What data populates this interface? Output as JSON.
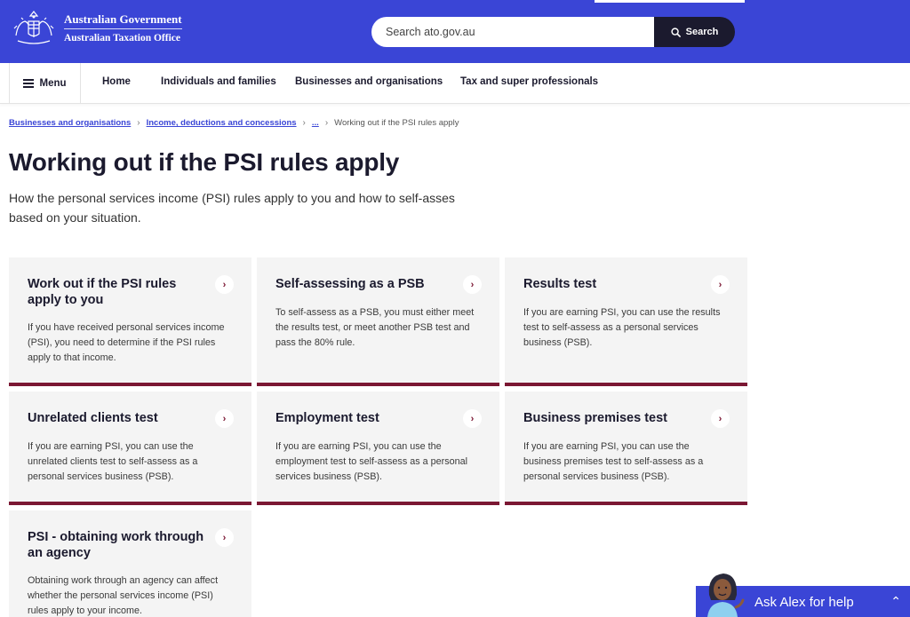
{
  "header": {
    "logo_line1": "Australian Government",
    "logo_line2": "Australian Taxation Office",
    "search_placeholder": "Search ato.gov.au",
    "search_button": "Search",
    "brand_color": "#3a45d6"
  },
  "nav": {
    "menu_label": "Menu",
    "items": [
      "Home",
      "Individuals and families",
      "Businesses and organisations",
      "Tax and super professionals"
    ]
  },
  "breadcrumb": {
    "items": [
      "Businesses and organisations",
      "Income, deductions and concessions",
      "..."
    ],
    "current": "Working out if the PSI rules apply"
  },
  "page": {
    "title": "Working out if the PSI rules apply",
    "intro": "How the personal services income (PSI) rules apply to you and how to self-asses based on your situation."
  },
  "cards": [
    {
      "title": "Work out if the PSI rules apply to you",
      "desc": "If you have received personal services income (PSI), you need to determine if the PSI rules apply to that income."
    },
    {
      "title": "Self-assessing as a PSB",
      "desc": "To self-assess as a PSB, you must either meet the results test, or meet another PSB test and pass the 80% rule."
    },
    {
      "title": "Results test",
      "desc": "If you are earning PSI, you can use the results test to self-assess as a personal services business (PSB)."
    },
    {
      "title": "Unrelated clients test",
      "desc": "If you are earning PSI, you can use the unrelated clients test to self-assess as a personal services business (PSB)."
    },
    {
      "title": "Employment test",
      "desc": "If you are earning PSI, you can use the employment test to self-assess as a personal services business (PSB)."
    },
    {
      "title": "Business premises test",
      "desc": "If you are earning PSI, you can use the business premises test to self-assess as a personal services business (PSB)."
    },
    {
      "title": "PSI - obtaining work through an agency",
      "desc": "Obtaining work through an agency can affect whether the personal services income (PSI) rules apply to your income."
    }
  ],
  "assistant": {
    "label": "Ask Alex for help"
  },
  "icons": {
    "search": "search-icon",
    "menu": "hamburger-icon",
    "chevron": "chevron-right-icon",
    "crest": "coat-of-arms-icon"
  }
}
